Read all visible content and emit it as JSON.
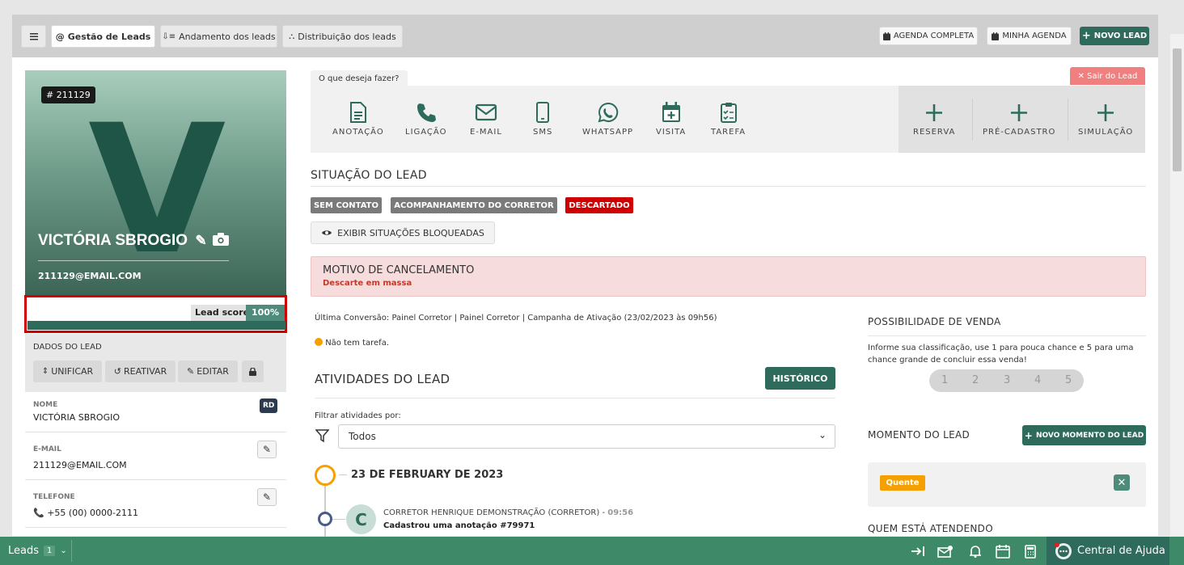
{
  "toolbar": {
    "menu_icon": "hamburger-icon",
    "tabs": [
      {
        "label": "Gestão de Leads",
        "icon": "at-icon",
        "active": true
      },
      {
        "label": "Andamento dos leads",
        "icon": "sort-icon",
        "active": false
      },
      {
        "label": "Distribuição dos leads",
        "icon": "sitemap-icon",
        "active": false
      }
    ],
    "agenda_completa": "AGENDA COMPLETA",
    "minha_agenda": "MINHA AGENDA",
    "novo_lead": "NOVO LEAD"
  },
  "profile": {
    "id_badge": "# 211129",
    "initial": "V",
    "name": "VICTÓRIA SBROGIO",
    "email": "211129@EMAIL.COM",
    "lead_score_label": "Lead score",
    "lead_score_value": "100%",
    "lead_score_fraction": 1.0
  },
  "dados": {
    "title": "DADOS DO LEAD",
    "unificar": "UNIFICAR",
    "reativar": "REATIVAR",
    "editar": "EDITAR"
  },
  "fields": {
    "nome_label": "NOME",
    "nome_value": "VICTÓRIA SBROGIO",
    "rd_badge": "RD",
    "email_label": "E-MAIL",
    "email_value": "211129@EMAIL.COM",
    "telefone_label": "TELEFONE",
    "telefone_value": "+55 (00) 0000-2111"
  },
  "actions": {
    "prompt": "O que deseja fazer?",
    "sair": "Sair do Lead",
    "items": [
      "ANOTAÇÃO",
      "LIGAÇÃO",
      "E-MAIL",
      "SMS",
      "WHATSAPP",
      "VISITA",
      "TAREFA"
    ],
    "extra": [
      "RESERVA",
      "PRÉ-CADASTRO",
      "SIMULAÇÃO"
    ]
  },
  "situacao": {
    "title": "SITUAÇÃO DO LEAD",
    "tags": [
      {
        "label": "SEM CONTATO",
        "color": "#7a7a7a"
      },
      {
        "label": "ACOMPANHAMENTO DO CORRETOR",
        "color": "#7a7a7a"
      },
      {
        "label": "DESCARTADO",
        "color": "#d00000"
      }
    ],
    "exibir": "EXIBIR SITUAÇÕES BLOQUEADAS"
  },
  "motivo": {
    "title": "MOTIVO DE CANCELAMENTO",
    "value": "Descarte em massa"
  },
  "conversao": "Última Conversão: Painel Corretor | Painel Corretor | Campanha de Ativação (23/02/2023 às 09h56)",
  "tarefa": "Não tem tarefa.",
  "atividades": {
    "title": "ATIVIDADES DO LEAD",
    "historico": "HISTÓRICO",
    "filtrar": "Filtrar atividades por:",
    "filter_value": "Todos",
    "date": "23 DE FEBRUARY DE 2023",
    "avatar": "C",
    "author": "CORRETOR HENRIQUE DEMONSTRAÇÃO (CORRETOR)",
    "time": "09:56",
    "description": "Cadastrou uma anotação #79971"
  },
  "venda": {
    "title": "POSSIBILIDADE DE VENDA",
    "hint": "Informe sua classificação, use 1 para pouca chance e 5 para uma chance grande de concluir essa venda!",
    "ratings": [
      "1",
      "2",
      "3",
      "4",
      "5"
    ]
  },
  "momento": {
    "title": "MOMENTO DO LEAD",
    "novo": "NOVO MOMENTO DO LEAD",
    "status": "Quente",
    "remove": "✕"
  },
  "atendendo": {
    "title": "QUEM ESTÁ ATENDENDO"
  },
  "bottombar": {
    "leads_label": "Leads",
    "leads_count": "1",
    "ajuda": "Central de Ajuda"
  },
  "colors": {
    "primary": "#2e6b5c",
    "bottom": "#3e8a68",
    "danger": "#d00000",
    "warning": "#f5a000"
  }
}
